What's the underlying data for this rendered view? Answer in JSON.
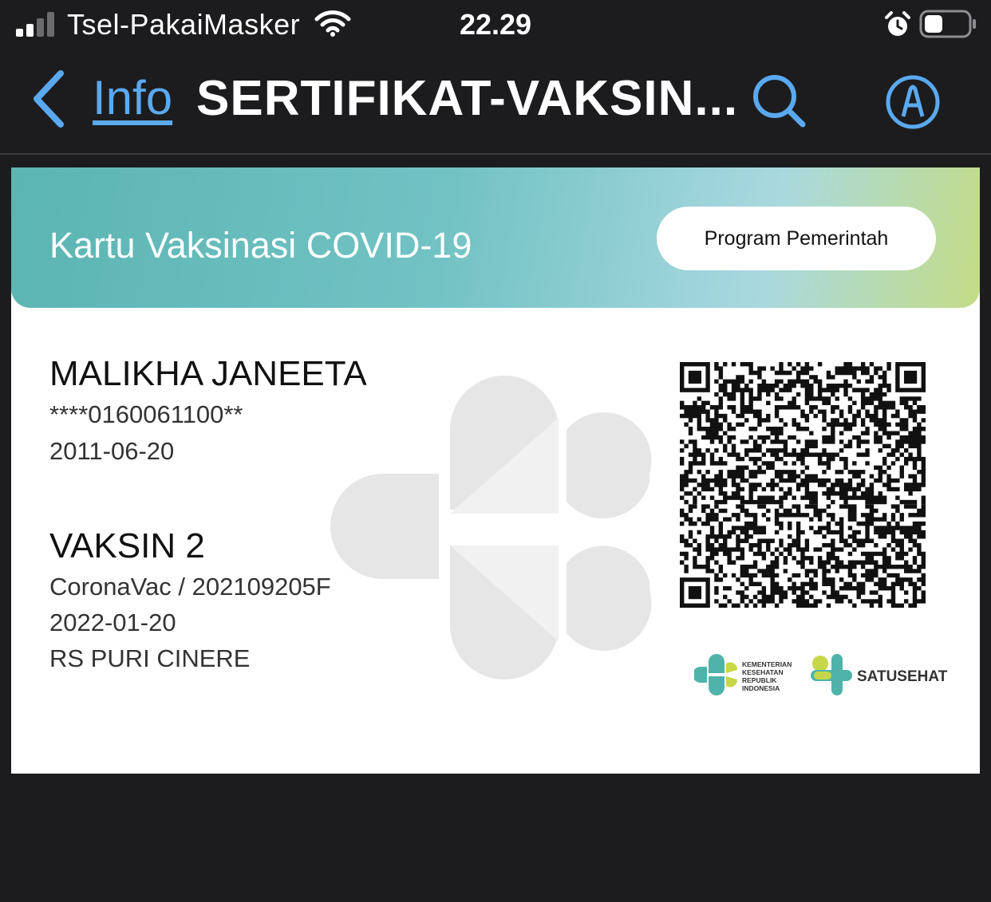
{
  "status_bar": {
    "carrier": "Tsel-PakaiMasker",
    "time": "22.29",
    "icons": [
      "signal-icon",
      "wifi-icon",
      "alarm-icon",
      "battery-icon"
    ]
  },
  "nav": {
    "back_label": "Info",
    "title": "SERTIFIKAT-VAKSIN...",
    "icons": [
      "back-chevron-icon",
      "search-icon",
      "markup-icon"
    ],
    "accent_color": "#5aa9f0"
  },
  "card": {
    "header": {
      "title": "Kartu Vaksinasi COVID-19",
      "badge": "Program Pemerintah"
    },
    "person": {
      "name": "MALIKHA JANEETA",
      "id_masked": "****0160061100**",
      "birth_date": "2011-06-20"
    },
    "vaccination": {
      "dose": "VAKSIN 2",
      "vaccine_batch": "CoronaVac / 202109205F",
      "date": "2022-01-20",
      "location": "RS PURI CINERE"
    },
    "logos": {
      "kemenkes_lines": [
        "KEMENTERIAN",
        "KESEHATAN",
        "REPUBLIK",
        "INDONESIA"
      ],
      "satusehat": "SATUSEHAT"
    },
    "colors": {
      "header_teal": "#5bb5b2",
      "header_lime": "#c4dc86",
      "logo_teal": "#4fb3a9",
      "logo_lime": "#c5d84a"
    }
  }
}
